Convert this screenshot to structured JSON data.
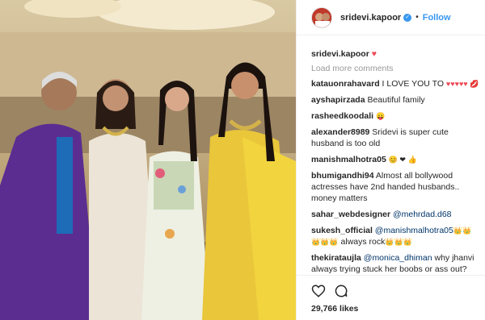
{
  "post": {
    "username": "sridevi.kapoor",
    "follow_label": "Follow",
    "dot": "•",
    "verified_glyph": "✓",
    "caption_user": "sridevi.kapoor",
    "caption_heart": "♥",
    "load_more": "Load more comments",
    "likes": "29,766 likes",
    "accent": "#3897f0",
    "heart_color": "#ed4956"
  },
  "comments": [
    {
      "user": "katauonrahavard",
      "text": " I LOVE YOU TO ",
      "extra": "♥♥♥♥♥ 💋"
    },
    {
      "user": "ayshapirzada",
      "text": " Beautiful family",
      "extra": ""
    },
    {
      "user": "rasheedkoodali",
      "text": " ",
      "extra": "😛"
    },
    {
      "user": "alexander8989",
      "text": " Sridevi is super cute husband is too old",
      "extra": ""
    },
    {
      "user": "manishmalhotra05",
      "text": " ",
      "extra": "😊 ❤ 👍"
    },
    {
      "user": "bhumigandhi94",
      "text": " Almost all bollywood actresses have 2nd handed husbands.. money matters",
      "extra": ""
    },
    {
      "user": "sahar_webdesigner",
      "mention": "@mehrdad.d68",
      "text": "",
      "extra": ""
    },
    {
      "user": "sukesh_official",
      "mention": "@manishmalhotra05",
      "text": " always rock",
      "extra": "👑👑👑👑👑"
    },
    {
      "user": "thekirataujla",
      "mention": "@monica_dhiman",
      "text": " why jhanvi always trying stuck her boobs or ass out?",
      "extra": ""
    }
  ],
  "icons": {
    "heart": "heart-icon",
    "comment": "comment-icon",
    "avatar": "avatar",
    "verified": "verified-badge-icon"
  }
}
